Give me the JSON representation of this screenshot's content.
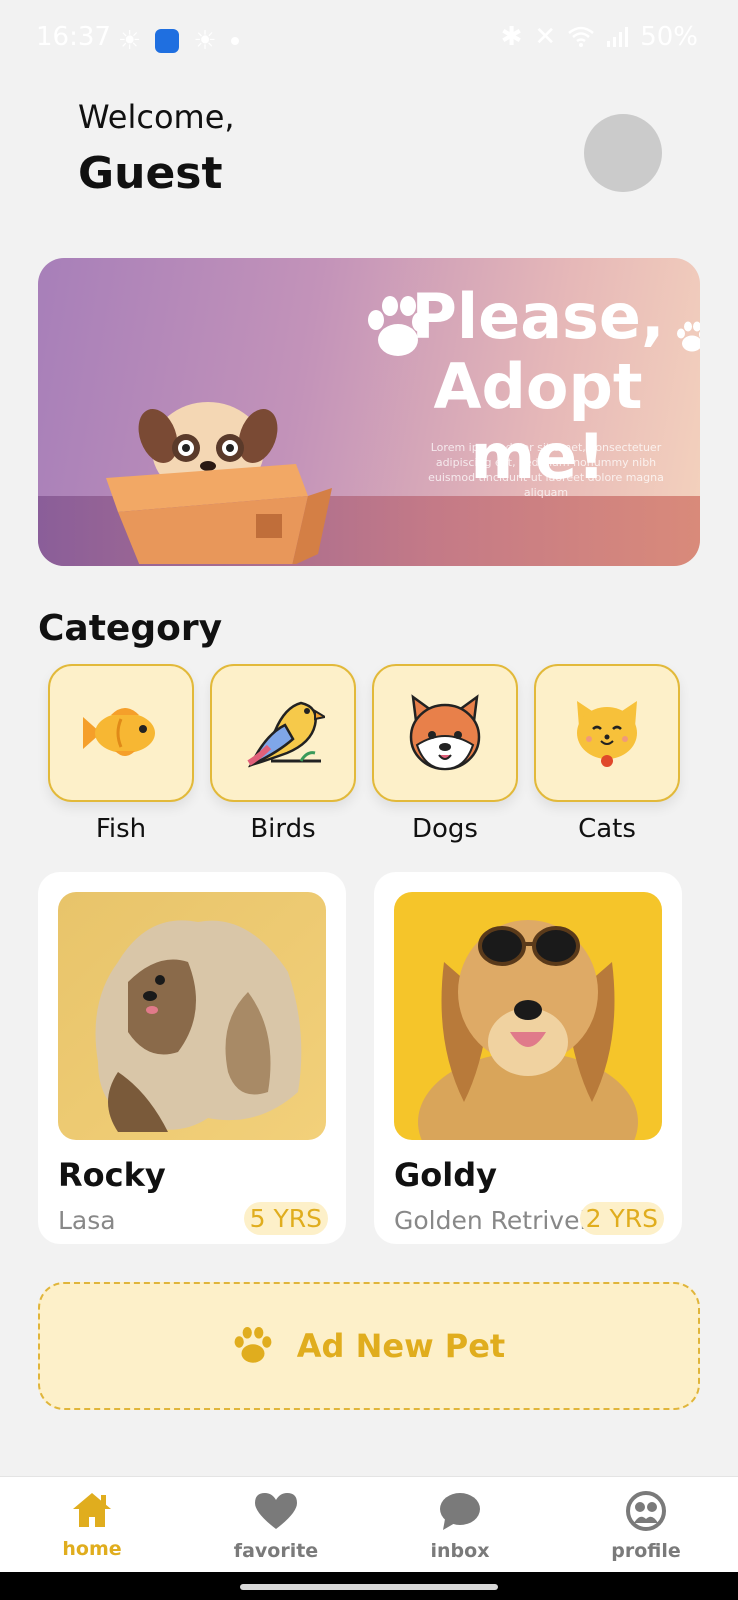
{
  "status_bar": {
    "time": "16:37",
    "battery": "50%"
  },
  "header": {
    "welcome": "Welcome,",
    "user_name": "Guest"
  },
  "banner": {
    "headline_line1": "Please,",
    "headline_line2": "Adopt me!",
    "body": "Lorem ipsum dolor sit amet, consectetuer adipiscing elit, sed diam nonummy nibh euismod tincidunt ut laoreet dolore magna aliquam"
  },
  "category": {
    "title": "Category",
    "items": [
      {
        "label": "Fish",
        "icon": "fish-icon"
      },
      {
        "label": "Birds",
        "icon": "bird-icon"
      },
      {
        "label": "Dogs",
        "icon": "dog-icon"
      },
      {
        "label": "Cats",
        "icon": "cat-icon"
      }
    ]
  },
  "pets": [
    {
      "name": "Rocky",
      "breed": "Lasa",
      "age": "5 YRS"
    },
    {
      "name": "Goldy",
      "breed": "Golden Retrivel",
      "age": "2 YRS"
    }
  ],
  "add_pet": {
    "label": "Ad New Pet",
    "icon": "paw-icon"
  },
  "bottom_nav": [
    {
      "label": "home",
      "icon": "home-icon",
      "active": true
    },
    {
      "label": "favorite",
      "icon": "heart-icon",
      "active": false
    },
    {
      "label": "inbox",
      "icon": "chat-icon",
      "active": false
    },
    {
      "label": "profile",
      "icon": "profile-icon",
      "active": false
    }
  ],
  "colors": {
    "accent": "#e0ad1e",
    "tile_bg": "#fdf0c9",
    "page_bg": "#f2f2f2"
  }
}
